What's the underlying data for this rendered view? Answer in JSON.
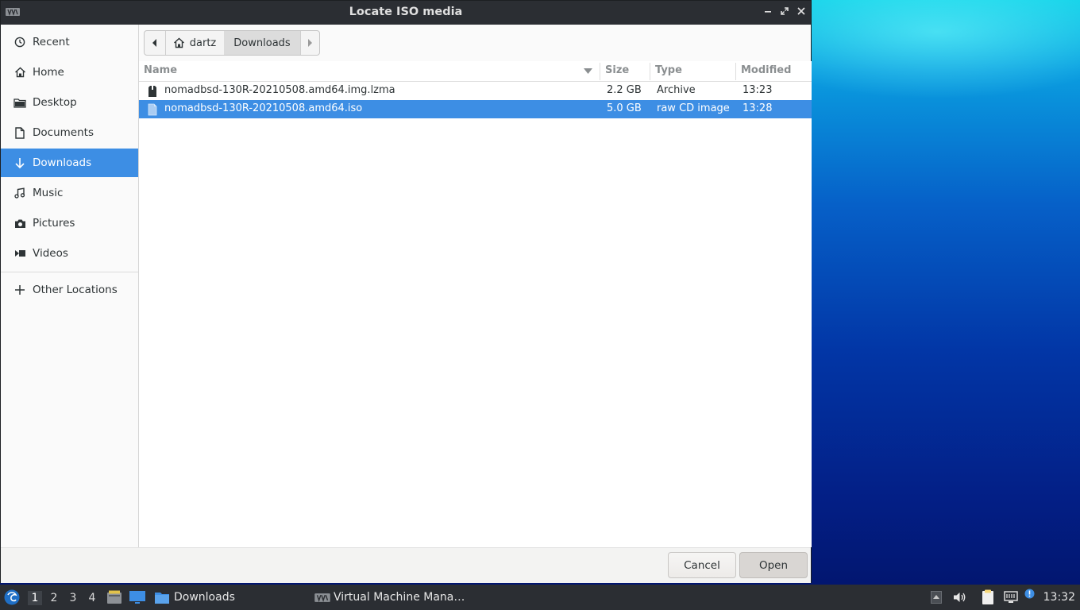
{
  "dialog": {
    "title": "Locate ISO media"
  },
  "sidebar": {
    "items": [
      {
        "label": "Recent",
        "icon": "clock-icon"
      },
      {
        "label": "Home",
        "icon": "home-icon"
      },
      {
        "label": "Desktop",
        "icon": "folder-icon"
      },
      {
        "label": "Documents",
        "icon": "document-icon"
      },
      {
        "label": "Downloads",
        "icon": "download-arrow-icon",
        "active": true
      },
      {
        "label": "Music",
        "icon": "music-note-icon"
      },
      {
        "label": "Pictures",
        "icon": "camera-icon"
      },
      {
        "label": "Videos",
        "icon": "video-icon"
      }
    ],
    "other": {
      "label": "Other Locations",
      "icon": "plus-icon"
    }
  },
  "pathbar": {
    "home_label": "dartz",
    "current_label": "Downloads"
  },
  "columns": {
    "name": "Name",
    "size": "Size",
    "type": "Type",
    "modified": "Modified"
  },
  "files": [
    {
      "name": "nomadbsd-130R-20210508.amd64.img.lzma",
      "size": "2.2 GB",
      "type": "Archive",
      "modified": "13:23",
      "icon": "archive-file-icon",
      "selected": false
    },
    {
      "name": "nomadbsd-130R-20210508.amd64.iso",
      "size": "5.0 GB",
      "type": "raw CD image",
      "modified": "13:28",
      "icon": "disc-image-file-icon",
      "selected": true
    }
  ],
  "buttons": {
    "cancel": "Cancel",
    "open": "Open"
  },
  "taskbar": {
    "workspaces": [
      "1",
      "2",
      "3",
      "4"
    ],
    "active_workspace": "1",
    "tasks": [
      {
        "label": "Downloads",
        "icon": "folder-icon"
      },
      {
        "label": "Virtual Machine Mana…",
        "icon": "virt-manager-icon"
      }
    ],
    "clock": "13:32"
  },
  "colors": {
    "accent": "#3d8ee4",
    "titlebar": "#2b2e33"
  }
}
